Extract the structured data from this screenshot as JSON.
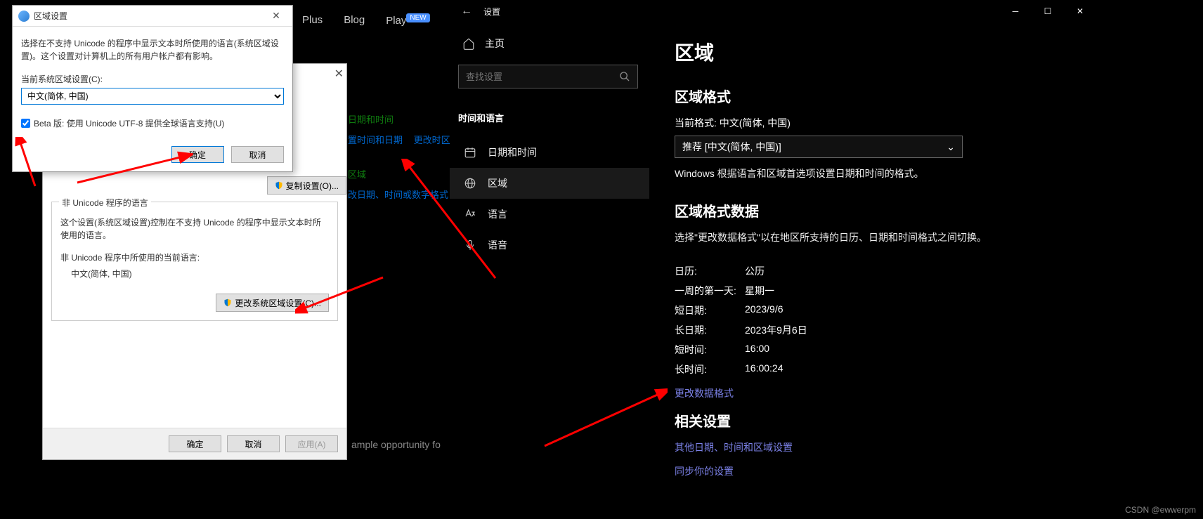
{
  "bg_nav": {
    "plus": "Plus",
    "blog": "Blog",
    "play": "Play",
    "new_badge": "NEW"
  },
  "bg_sample_text": "ample opportunity fo",
  "region_dialog": {
    "title": "区域设置",
    "desc": "选择在不支持 Unicode 的程序中显示文本时所使用的语言(系统区域设置)。这个设置对计算机上的所有用户帐户都有影响。",
    "current_label": "当前系统区域设置(C):",
    "current_value": "中文(简体, 中国)",
    "beta_checkbox": "Beta 版: 使用 Unicode UTF-8 提供全球语言支持(U)",
    "ok": "确定",
    "cancel": "取消"
  },
  "cp_dialog": {
    "copy_btn": "复制设置(O)...",
    "group_legend": "非 Unicode 程序的语言",
    "group_desc": "这个设置(系统区域设置)控制在不支持 Unicode 的程序中显示文本时所使用的语言。",
    "current_lang_label": "非 Unicode 程序中所使用的当前语言:",
    "current_lang_value": "中文(简体, 中国)",
    "change_btn": "更改系统区域设置(C)...",
    "ok": "确定",
    "cancel": "取消",
    "apply": "应用(A)"
  },
  "bg_links": {
    "heading1": "日期和时间",
    "link1a": "置时间和日期",
    "link1b": "更改时区",
    "heading2": "区域",
    "link2a": "改日期、时间或数字格式"
  },
  "settings": {
    "title": "设置",
    "home": "主页",
    "search_placeholder": "查找设置",
    "section": "时间和语言",
    "items": {
      "datetime": "日期和时间",
      "region": "区域",
      "language": "语言",
      "speech": "语音"
    },
    "page": {
      "title": "区域",
      "format_heading": "区域格式",
      "current_format_label": "当前格式: 中文(简体, 中国)",
      "combo_value": "推荐 [中文(简体, 中国)]",
      "format_desc": "Windows 根据语言和区域首选项设置日期和时间的格式。",
      "data_heading": "区域格式数据",
      "data_desc": "选择\"更改数据格式\"以在地区所支持的日历、日期和时间格式之间切换。",
      "rows": [
        {
          "key": "日历:",
          "val": "公历"
        },
        {
          "key": "一周的第一天:",
          "val": "星期一"
        },
        {
          "key": "短日期:",
          "val": "2023/9/6"
        },
        {
          "key": "长日期:",
          "val": "2023年9月6日"
        },
        {
          "key": "短时间:",
          "val": "16:00"
        },
        {
          "key": "长时间:",
          "val": "16:00:24"
        }
      ],
      "change_format_link": "更改数据格式",
      "related_heading": "相关设置",
      "related_link": "其他日期、时间和区域设置",
      "sync_link": "同步你的设置"
    }
  },
  "watermark": "CSDN @ewwerpm"
}
